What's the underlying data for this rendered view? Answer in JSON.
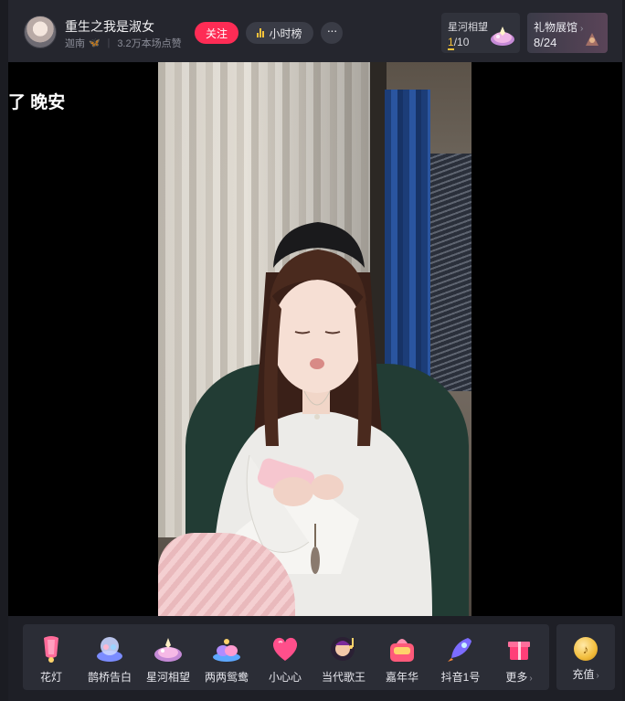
{
  "header": {
    "streamer_name": "重生之我是淑女",
    "sub_name": "迦南",
    "likes": "3.2万本场点赞",
    "follow_label": "关注",
    "rank_label": "小时榜",
    "more_label": "···",
    "star_card": {
      "title": "星河相望",
      "current": "1",
      "total": "/10"
    },
    "gift_hall": {
      "title": "礼物展馆",
      "chevron": "›",
      "progress": "8/24"
    }
  },
  "video": {
    "danmaku": "了 晚安"
  },
  "gift_bar": {
    "items": [
      {
        "label": "花灯",
        "icon": "lantern-icon"
      },
      {
        "label": "鹊桥告白",
        "icon": "magpie-bridge-icon"
      },
      {
        "label": "星河相望",
        "icon": "star-river-icon"
      },
      {
        "label": "两两鸳鸯",
        "icon": "mandarin-duck-icon"
      },
      {
        "label": "小心心",
        "icon": "heart-icon"
      },
      {
        "label": "当代歌王",
        "icon": "song-king-icon"
      },
      {
        "label": "嘉年华",
        "icon": "carnival-icon"
      },
      {
        "label": "抖音1号",
        "icon": "rocket-icon"
      }
    ],
    "more_label": "更多",
    "recharge_label": "充值",
    "chevron": "›"
  },
  "colors": {
    "follow": "#fe2c55",
    "accent_yellow": "#f7c23a",
    "background": "#1b1c22"
  }
}
